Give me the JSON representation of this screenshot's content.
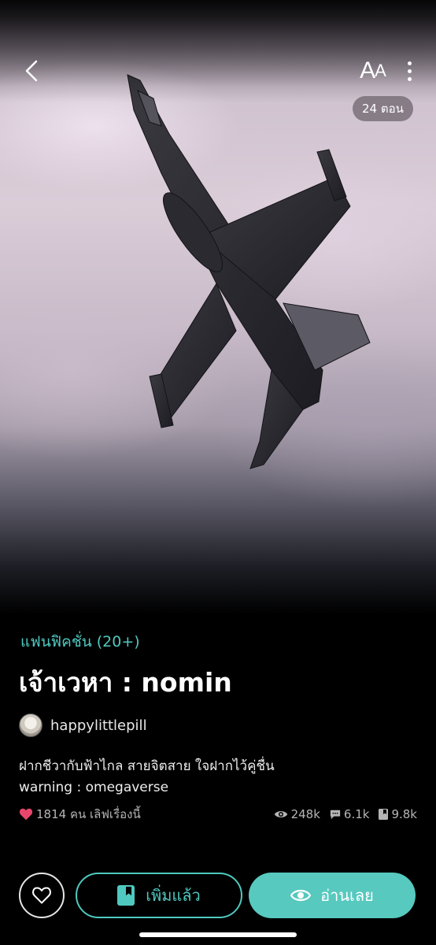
{
  "header": {
    "font_button_big": "A",
    "font_button_small": "A",
    "episodes_label": "24 ตอน"
  },
  "story": {
    "genre": "แฟนฟิคชั่น (20+)",
    "title": "เจ้าเวหา : nomin",
    "author": "happylittlepill",
    "synopsis_line1": "ฝากชีวากับฟ้าไกล สายจิตสาย ใจฝากไว้คู่ชื่น",
    "synopsis_line2": "warning : omegaverse"
  },
  "stats": {
    "loves": "1814 คน เลิฟเรื่องนี้",
    "views": "248k",
    "comments": "6.1k",
    "bookmarks": "9.8k"
  },
  "actions": {
    "added_label": "เพิ่มแล้ว",
    "read_label": "อ่านเลย"
  },
  "colors": {
    "accent": "#4fc9c0",
    "heart": "#e8476b",
    "background": "#000000"
  },
  "icons": [
    "back-icon",
    "font-size-icon",
    "more-vertical-icon",
    "heart-icon",
    "eye-icon",
    "comment-icon",
    "bookmark-icon"
  ]
}
